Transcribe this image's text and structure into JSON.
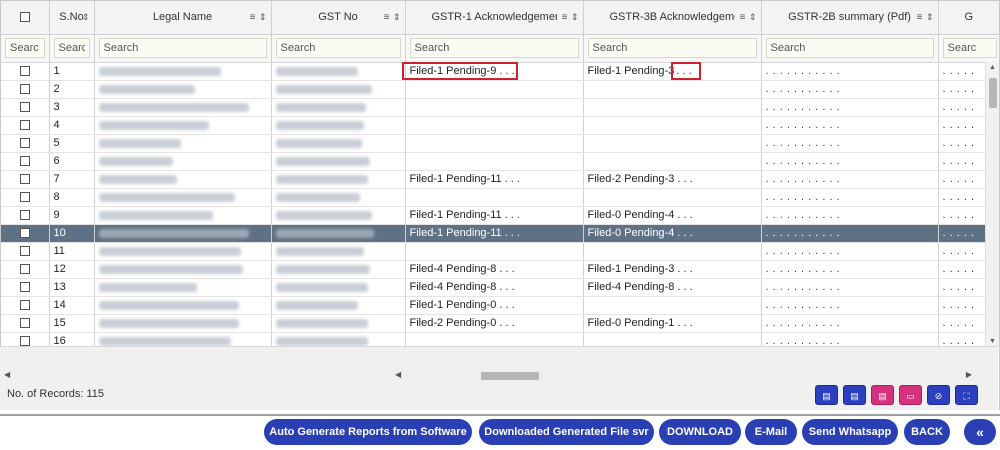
{
  "columns": {
    "sno": "S.No",
    "legal_name": "Legal Name",
    "gst_no": "GST No",
    "gstr1": "GSTR-1 Acknowledgemer",
    "gstr3b": "GSTR-3B Acknowledgeme",
    "gstr2b": "GSTR-2B summary (Pdf)",
    "next": "G"
  },
  "filters": {
    "sno_placeholder": "Searc",
    "first_placeholder": "Searc",
    "search_placeholder": "Search"
  },
  "rows": [
    {
      "sno": "1",
      "gstr1": "Filed-1 Pending-9 . . .",
      "gstr3b": "Filed-1 Pending-3",
      "gstr3b_tail": ". . .",
      "gstr2b": ". . . . . . . . . . .",
      "next": ". . . . ."
    },
    {
      "sno": "2",
      "gstr1": "",
      "gstr3b": "",
      "gstr3b_tail": "",
      "gstr2b": ". . . . . . . . . . .",
      "next": ". . . . ."
    },
    {
      "sno": "3",
      "gstr1": "",
      "gstr3b": "",
      "gstr3b_tail": "",
      "gstr2b": ". . . . . . . . . . .",
      "next": ". . . . ."
    },
    {
      "sno": "4",
      "gstr1": "",
      "gstr3b": "",
      "gstr3b_tail": "",
      "gstr2b": ". . . . . . . . . . .",
      "next": ". . . . ."
    },
    {
      "sno": "5",
      "gstr1": "",
      "gstr3b": "",
      "gstr3b_tail": "",
      "gstr2b": ". . . . . . . . . . .",
      "next": ". . . . ."
    },
    {
      "sno": "6",
      "gstr1": "",
      "gstr3b": "",
      "gstr3b_tail": "",
      "gstr2b": ". . . . . . . . . . .",
      "next": ". . . . ."
    },
    {
      "sno": "7",
      "gstr1": "Filed-1 Pending-11 . . .",
      "gstr3b": "Filed-2 Pending-3 . . .",
      "gstr3b_tail": "",
      "gstr2b": ". . . . . . . . . . .",
      "next": ". . . . ."
    },
    {
      "sno": "8",
      "gstr1": "",
      "gstr3b": "",
      "gstr3b_tail": "",
      "gstr2b": ". . . . . . . . . . .",
      "next": ". . . . ."
    },
    {
      "sno": "9",
      "gstr1": "Filed-1 Pending-11 . . .",
      "gstr3b": "Filed-0 Pending-4 . . .",
      "gstr3b_tail": "",
      "gstr2b": ". . . . . . . . . . .",
      "next": ". . . . ."
    },
    {
      "sno": "10",
      "gstr1": "Filed-1 Pending-11 . . .",
      "gstr3b": "Filed-0 Pending-4 . . .",
      "gstr3b_tail": "",
      "gstr2b": ". . . . . . . . . . .",
      "next": ". . . . ."
    },
    {
      "sno": "11",
      "gstr1": "",
      "gstr3b": "",
      "gstr3b_tail": "",
      "gstr2b": ". . . . . . . . . . .",
      "next": ". . . . ."
    },
    {
      "sno": "12",
      "gstr1": "Filed-4 Pending-8 . . .",
      "gstr3b": "Filed-1 Pending-3 . . .",
      "gstr3b_tail": "",
      "gstr2b": ". . . . . . . . . . .",
      "next": ". . . . ."
    },
    {
      "sno": "13",
      "gstr1": "Filed-4 Pending-8 . . .",
      "gstr3b": "Filed-4 Pending-8 . . .",
      "gstr3b_tail": "",
      "gstr2b": ". . . . . . . . . . .",
      "next": ". . . . ."
    },
    {
      "sno": "14",
      "gstr1": "Filed-1 Pending-0 . . .",
      "gstr3b": "",
      "gstr3b_tail": "",
      "gstr2b": ". . . . . . . . . . .",
      "next": ". . . . ."
    },
    {
      "sno": "15",
      "gstr1": "Filed-2 Pending-0 . . .",
      "gstr3b": "Filed-0 Pending-1 . . .",
      "gstr3b_tail": "",
      "gstr2b": ". . . . . . . . . . .",
      "next": ". . . . ."
    },
    {
      "sno": "16",
      "gstr1": "",
      "gstr3b": "",
      "gstr3b_tail": "",
      "gstr2b": ". . . . . . . . . . .",
      "next": ". . . . ."
    }
  ],
  "selected_row": 10,
  "footer": {
    "records_label": "No. of Records: 115"
  },
  "export_buttons": [
    {
      "icon": "file-icon",
      "color": "#2b3fbf"
    },
    {
      "icon": "file-text-icon",
      "color": "#2b3fbf"
    },
    {
      "icon": "pdf-icon",
      "color": "#d6317c"
    },
    {
      "icon": "folder-icon",
      "color": "#d6317c"
    },
    {
      "icon": "eye-off-icon",
      "color": "#2b3fbf"
    },
    {
      "icon": "expand-icon",
      "color": "#2b3fbf"
    }
  ],
  "actions": {
    "auto_generate": "Auto Generate Reports from Software",
    "downloaded_file": "Downloaded Generated File svr",
    "download": "DOWNLOAD",
    "email": "E-Mail",
    "whatsapp": "Send Whatsapp",
    "back": "BACK",
    "collapse_icon": "«"
  },
  "colors": {
    "accent": "#2a3fb3",
    "selected_row": "#5f7185",
    "highlight_box": "#d01f2f",
    "pink": "#d6317c"
  }
}
